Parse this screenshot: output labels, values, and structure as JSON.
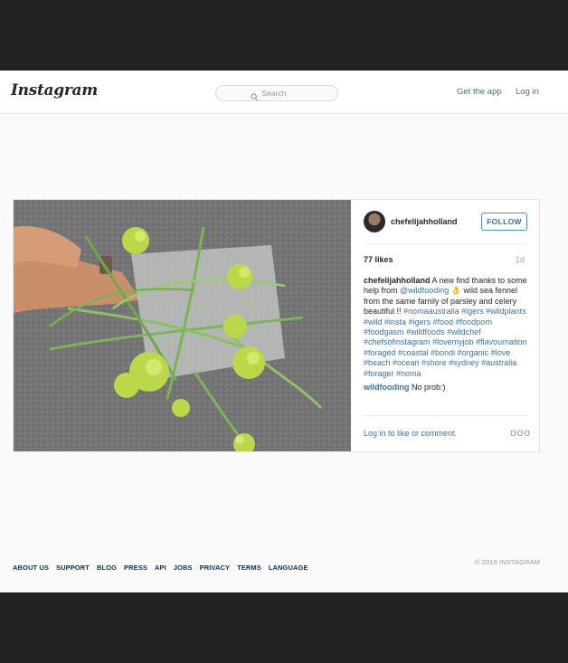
{
  "header": {
    "logo": "Instagram",
    "search_placeholder": "Search",
    "get_app": "Get the app",
    "login": "Log in"
  },
  "post": {
    "username": "chefelijahholland",
    "follow": "FOLLOW",
    "likes": "77 likes",
    "age": "1d",
    "caption": {
      "text_1": "A new find thanks to some help from",
      "mention": "@wildfooding",
      "emoji": "👌",
      "text_2": "wild sea fennel from the same family of parsley and celery beautiful !!",
      "hashtags": [
        "#nomaaustralia",
        "#igers",
        "#wildplants",
        "#wild",
        "#insta",
        "#igers",
        "#food",
        "#foodporn",
        "#foodgasm",
        "#wildfoods",
        "#wildchef",
        "#chefsofinstagram",
        "#lovemyjob",
        "#flavournation",
        "#foraged",
        "#coastal",
        "#bondi",
        "#organic",
        "#love",
        "#beach",
        "#ocean",
        "#shore",
        "#sydney",
        "#australia",
        "#forager",
        "#noma"
      ]
    },
    "comment": {
      "username": "wildfooding",
      "text": "No prob:)"
    },
    "login_to_comment": "Log in to like or comment.",
    "more": "ooo"
  },
  "footer": {
    "links": [
      "ABOUT US",
      "SUPPORT",
      "BLOG",
      "PRESS",
      "API",
      "JOBS",
      "PRIVACY",
      "TERMS",
      "LANGUAGE"
    ],
    "copyright": "© 2016 INSTAGRAM"
  }
}
